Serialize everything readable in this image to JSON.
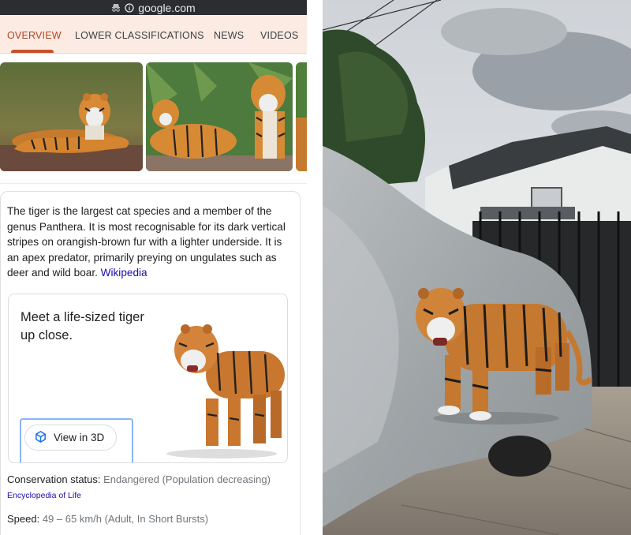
{
  "browser": {
    "url": "google.com"
  },
  "tabs": [
    {
      "label": "OVERVIEW",
      "active": true
    },
    {
      "label": "LOWER CLASSIFICATIONS",
      "active": false
    },
    {
      "label": "NEWS",
      "active": false
    },
    {
      "label": "VIDEOS",
      "active": false
    }
  ],
  "description": {
    "text": "The tiger is the largest cat species and a member of the genus Panthera. It is most recognisable for its dark vertical stripes on orangish-brown fur with a lighter underside. It is an apex predator, primarily preying on ungulates such as deer and wild boar.",
    "source_link": "Wikipedia"
  },
  "ar_card": {
    "title": "Meet a life-sized tiger up close.",
    "button_label": "View in 3D"
  },
  "facts": {
    "conservation_label": "Conservation status:",
    "conservation_value": "Endangered (Population decreasing)",
    "conservation_source": "Encyclopedia of Life",
    "speed_label": "Speed:",
    "speed_value": "49 – 65 km/h (Adult, In Short Bursts)"
  },
  "colors": {
    "accent": "#c6502a",
    "tab_bar_bg": "#fbebe3",
    "link": "#1a0dab"
  },
  "icons": [
    "lock-icon",
    "incognito-icon",
    "view-in-3d-cube-icon"
  ]
}
